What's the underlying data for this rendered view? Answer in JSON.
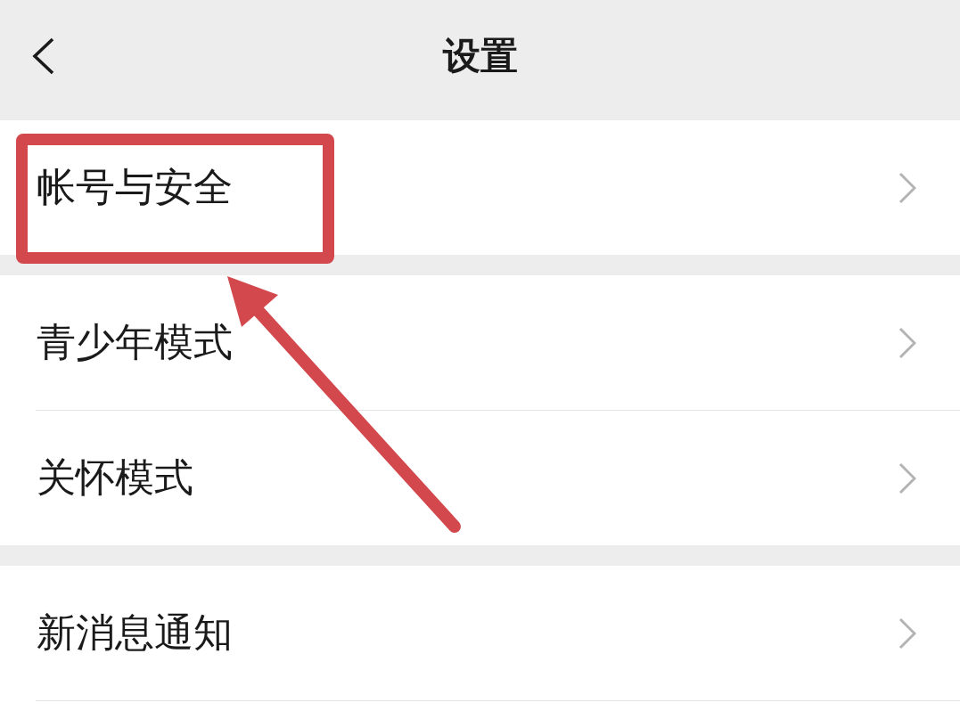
{
  "header": {
    "title": "设置"
  },
  "groups": [
    {
      "items": [
        {
          "label": "帐号与安全",
          "highlighted": true
        }
      ]
    },
    {
      "items": [
        {
          "label": "青少年模式",
          "highlighted": false
        },
        {
          "label": "关怀模式",
          "highlighted": false
        }
      ]
    },
    {
      "items": [
        {
          "label": "新消息通知",
          "highlighted": false
        }
      ]
    }
  ]
}
